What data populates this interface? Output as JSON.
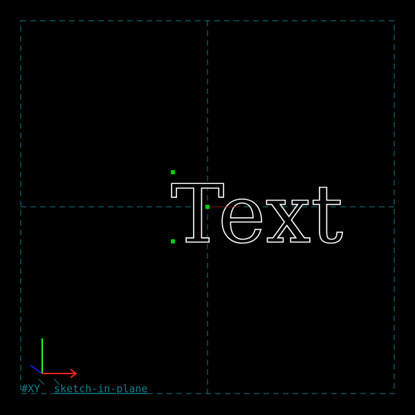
{
  "colors": {
    "background": "#000000",
    "workplane_border": "#0f7f8c",
    "crosshair": "#0f7f8c",
    "axis_x": "#ff2020",
    "axis_y": "#20ff20",
    "axis_z": "#2020ff",
    "text_outline": "#ffffff",
    "handle": "#00cc00",
    "baseline_ref": "#8b1a1a"
  },
  "sketch": {
    "text_entity": "Text"
  },
  "workplane": {
    "label_plane": "#XY",
    "label_group": "sketch-in-plane"
  },
  "icons": {
    "axis_gizmo": "xyz-axis-gizmo-icon",
    "handle": "point-handle-icon"
  }
}
